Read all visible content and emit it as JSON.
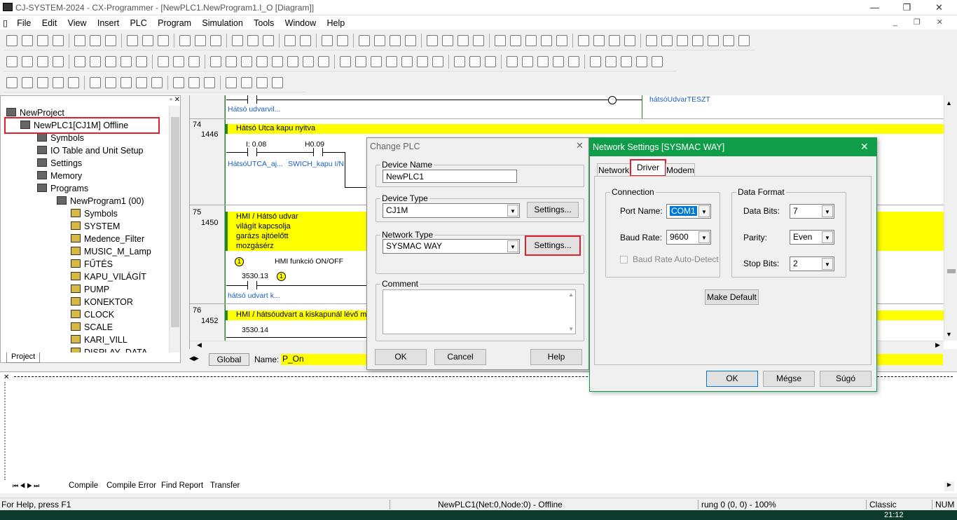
{
  "window": {
    "title": "CJ-SYSTEM-2024 - CX-Programmer - [NewPLC1.NewProgram1.I_O [Diagram]]",
    "minimize": "—",
    "restore": "❐",
    "close": "✕"
  },
  "menu": [
    "File",
    "Edit",
    "View",
    "Insert",
    "PLC",
    "Program",
    "Simulation",
    "Tools",
    "Window",
    "Help"
  ],
  "project": {
    "tab": "Project",
    "items": [
      {
        "label": "NewProject",
        "level": 0
      },
      {
        "label": "NewPLC1[CJ1M] Offline",
        "level": 1
      },
      {
        "label": "Symbols",
        "level": 2
      },
      {
        "label": "IO Table and Unit Setup",
        "level": 2
      },
      {
        "label": "Settings",
        "level": 2
      },
      {
        "label": "Memory",
        "level": 2
      },
      {
        "label": "Programs",
        "level": 2
      },
      {
        "label": "NewProgram1 (00)",
        "level": 3
      },
      {
        "label": "Symbols",
        "level": 4
      },
      {
        "label": "SYSTEM",
        "level": 4
      },
      {
        "label": "Medence_Filter",
        "level": 4
      },
      {
        "label": "MUSIC_M_Lamp",
        "level": 4
      },
      {
        "label": "FŰTÉS",
        "level": 4
      },
      {
        "label": "KAPU_VILÁGÍT",
        "level": 4
      },
      {
        "label": "PUMP",
        "level": 4
      },
      {
        "label": "KONEKTOR",
        "level": 4
      },
      {
        "label": "CLOCK",
        "level": 4
      },
      {
        "label": "SCALE",
        "level": 4
      },
      {
        "label": "KARI_VILL",
        "level": 4
      },
      {
        "label": "DISPLAY_DATA",
        "level": 4
      }
    ]
  },
  "ladder": {
    "top_contact": "Hátsó udvarvil...",
    "top_output": "hátsóUdvarTESZT",
    "rung74": {
      "no": "74",
      "step": "1446",
      "comment": "Hátsó Utca kapu nyitva",
      "c1_addr": "I: 0.08",
      "c2_addr": "H0.09",
      "c1_name": "HátsóUTCA_aj...",
      "c2_name": "SWICH_kapu I/N"
    },
    "rung75": {
      "no": "75",
      "step": "1450",
      "comment": [
        "HMI / Hátsó udvar",
        "világít kapcsolja",
        "garázs ajtóelőtt",
        "mozgásérz"
      ],
      "marker1": "1",
      "marker_text": "HMI funkció ON/OFF",
      "addr": "3530.13",
      "marker2": "1",
      "name": "hátsó udvart k..."
    },
    "rung76": {
      "no": "76",
      "step": "1452",
      "comment": "HMI / hátsóudvart a kiskapunál lévő moz",
      "addr": "3530.14"
    },
    "global": "Global",
    "name_label": "Name:",
    "name_value": "P_On"
  },
  "output_tabs": [
    "Compile",
    "Compile Error",
    "Find Report",
    "Transfer"
  ],
  "change_plc": {
    "title": "Change PLC",
    "device_name_label": "Device Name",
    "device_name": "NewPLC1",
    "device_type_label": "Device Type",
    "device_type": "CJ1M",
    "settings": "Settings...",
    "network_type_label": "Network Type",
    "network_type": "SYSMAC WAY",
    "settings2": "Settings...",
    "comment_label": "Comment",
    "ok": "OK",
    "cancel": "Cancel",
    "help": "Help"
  },
  "network": {
    "title": "Network Settings [SYSMAC WAY]",
    "tabs": [
      "Network",
      "Driver",
      "Modem"
    ],
    "connection_label": "Connection",
    "port_label": "Port Name:",
    "port": "COM1",
    "baud_label": "Baud Rate:",
    "baud": "9600",
    "autodetect": "Baud Rate Auto-Detect",
    "format_label": "Data Format",
    "bits_label": "Data Bits:",
    "bits": "7",
    "parity_label": "Parity:",
    "parity": "Even",
    "stop_label": "Stop Bits:",
    "stop": "2",
    "make_default": "Make Default",
    "ok": "OK",
    "cancel": "Mégse",
    "help": "Súgó"
  },
  "status": {
    "help": "For Help, press F1",
    "plc": "NewPLC1(Net:0,Node:0) - Offline",
    "rung": "rung 0 (0, 0)  - 100%",
    "mode": "Classic",
    "num": "NUM",
    "time": "21:12"
  },
  "colors": {
    "title_green": "#0f9d4a",
    "highlight_red": "#e0202a",
    "comment_yellow": "#ffff00"
  }
}
